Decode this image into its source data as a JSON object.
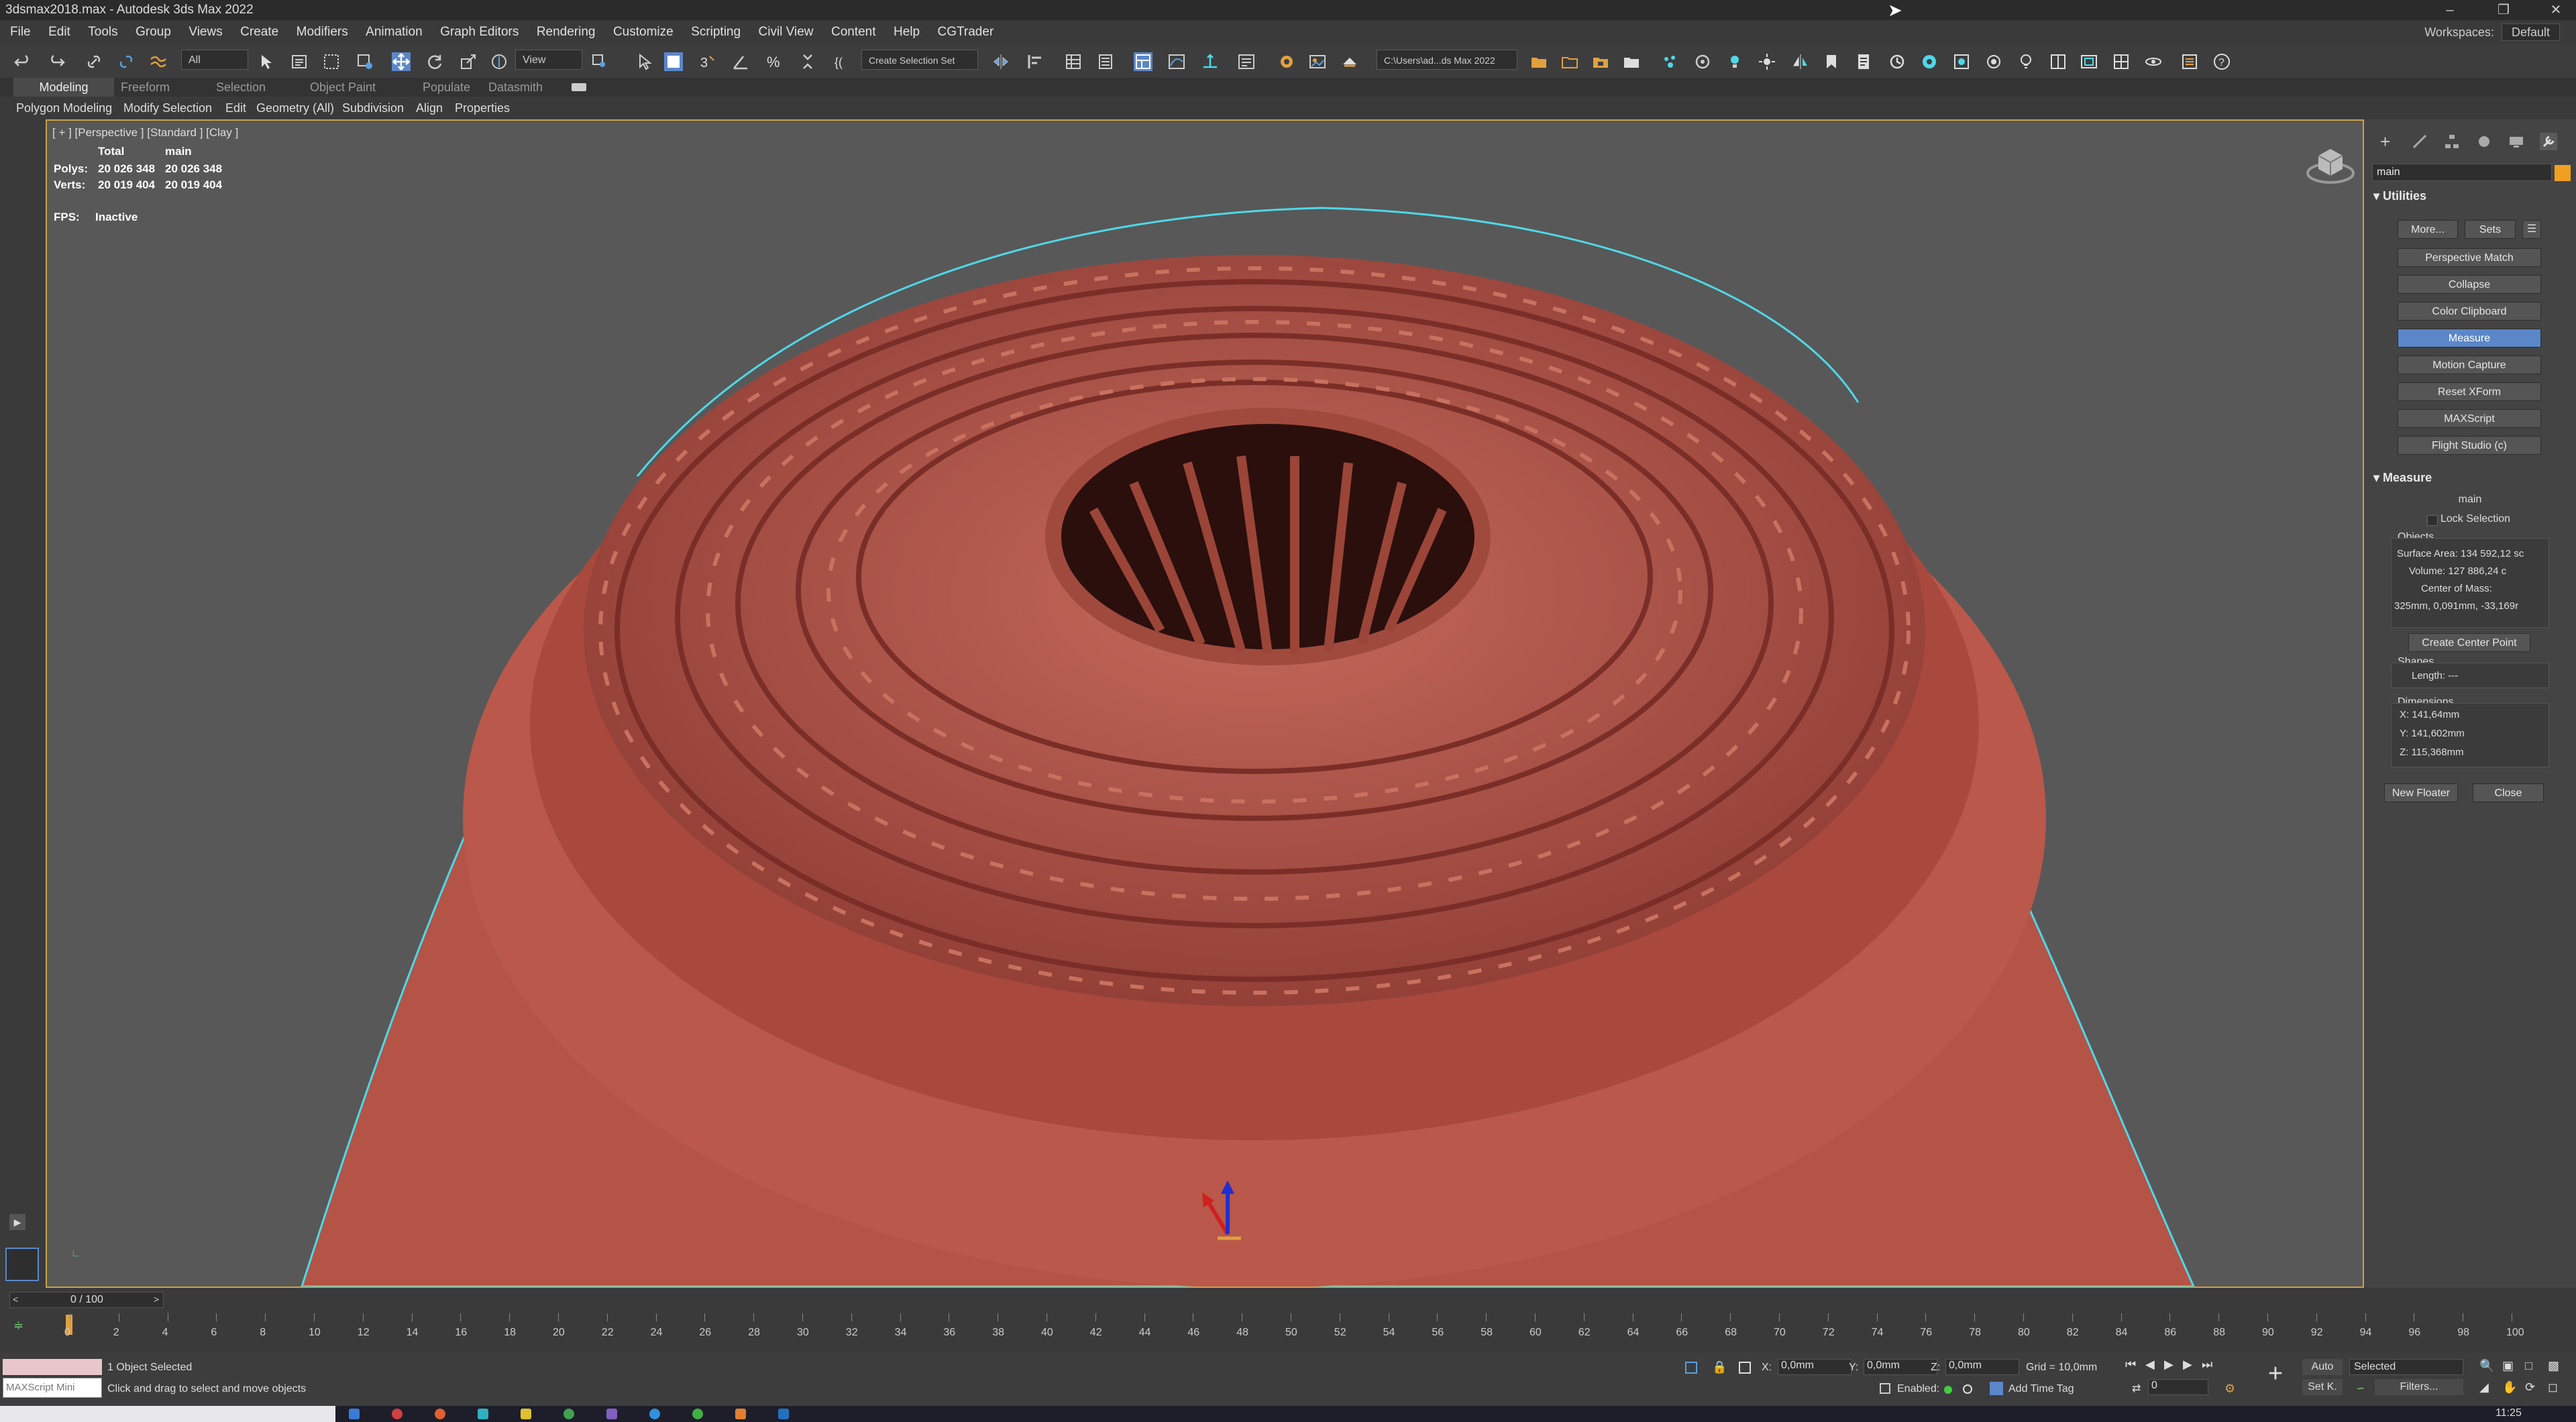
{
  "window": {
    "title": "3dsmax2018.max - Autodesk 3ds Max 2022"
  },
  "menu": [
    "File",
    "Edit",
    "Tools",
    "Group",
    "Views",
    "Create",
    "Modifiers",
    "Animation",
    "Graph Editors",
    "Rendering",
    "Customize",
    "Scripting",
    "Civil View",
    "Content",
    "Help",
    "CGTrader"
  ],
  "workspace": {
    "label": "Workspaces:",
    "value": "Default"
  },
  "toolbar": {
    "selection_filter": "All",
    "reference_coord": "View",
    "named_selection": "Create Selection Set",
    "project_path": "C:\\Users\\ad...ds Max 2022"
  },
  "ribbon": {
    "tabs": [
      "Modeling",
      "Freeform",
      "Selection",
      "Object Paint",
      "Populate",
      "Datasmith"
    ],
    "panels": [
      "Polygon Modeling",
      "Modify Selection",
      "Edit",
      "Geometry (All)",
      "Subdivision",
      "Align",
      "Properties"
    ]
  },
  "viewport": {
    "label": "[ + ] [Perspective ] [Standard ] [Clay ]",
    "stats": {
      "col_total": "Total",
      "col_main": "main",
      "polys_label": "Polys:",
      "polys_total": "20 026 348",
      "polys_main": "20 026 348",
      "verts_label": "Verts:",
      "verts_total": "20 019 404",
      "verts_main": "20 019 404",
      "fps_label": "FPS:",
      "fps_value": "Inactive"
    },
    "colors": {
      "clay": "#b5534a",
      "selection_outline": "#4fd8e8",
      "background": "#585858"
    }
  },
  "command_panel": {
    "object_name": "main",
    "utilities": {
      "title": "Utilities",
      "more": "More...",
      "sets": "Sets",
      "buttons": [
        "Perspective Match",
        "Collapse",
        "Color Clipboard",
        "Measure",
        "Motion Capture",
        "Reset XForm",
        "MAXScript",
        "Flight Studio (c)"
      ],
      "active": "Measure"
    },
    "measure": {
      "title": "Measure",
      "name": "main",
      "lock_selection": "Lock Selection",
      "objects_label": "Objects",
      "surface_area": "Surface Area: 134 592,12 sc",
      "volume": "Volume:  127 886,24 c",
      "center_of_mass": "Center of Mass:",
      "com_value": "325mm, 0,091mm, -33,169r",
      "create_center_point": "Create Center Point",
      "shapes_label": "Shapes",
      "length": "Length:  ---",
      "dimensions_label": "Dimensions",
      "dim_x": "X:  141,64mm",
      "dim_y": "Y:  141,602mm",
      "dim_z": "Z:  115,368mm",
      "new_floater": "New Floater",
      "close": "Close"
    }
  },
  "timeline": {
    "frame": "0 / 100",
    "ticks": [
      "0",
      "2",
      "4",
      "6",
      "8",
      "10",
      "12",
      "14",
      "16",
      "18",
      "20",
      "22",
      "24",
      "26",
      "28",
      "30",
      "32",
      "34",
      "36",
      "38",
      "40",
      "42",
      "44",
      "46",
      "48",
      "50",
      "52",
      "54",
      "56",
      "58",
      "60",
      "62",
      "64",
      "66",
      "68",
      "70",
      "72",
      "74",
      "76",
      "78",
      "80",
      "82",
      "84",
      "86",
      "88",
      "90",
      "92",
      "94",
      "96",
      "98",
      "100"
    ]
  },
  "status": {
    "maxscript": "MAXScript Mini",
    "selected": "1 Object Selected",
    "prompt": "Click and drag to select and move objects",
    "x_label": "X:",
    "x_value": "0,0mm",
    "y_label": "Y:",
    "y_value": "0,0mm",
    "z_label": "Z:",
    "z_value": "0,0mm",
    "grid": "Grid = 10,0mm",
    "enabled": "Enabled:",
    "add_time_tag": "Add Time Tag",
    "auto": "Auto",
    "set_key": "Set K.",
    "selected_dropdown": "Selected",
    "filters": "Filters...",
    "frame_field": "0",
    "clock": "11:25"
  }
}
